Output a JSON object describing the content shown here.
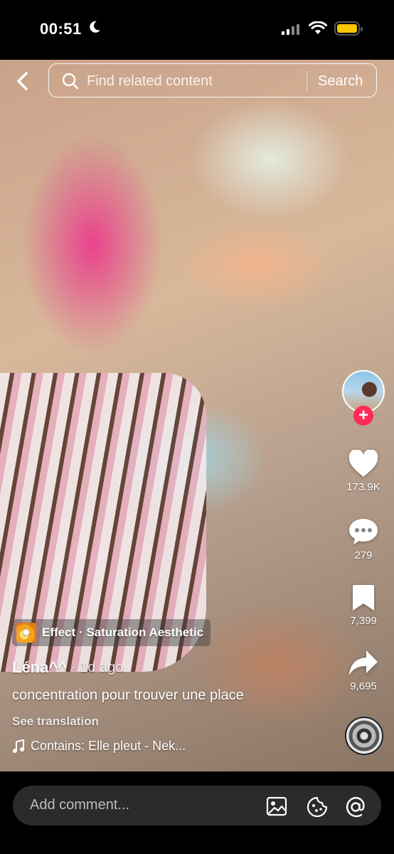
{
  "status": {
    "time": "00:51"
  },
  "nav": {
    "search_placeholder": "Find related content",
    "search_button": "Search"
  },
  "rail": {
    "likes": "173.9K",
    "comments": "279",
    "saves": "7,399",
    "shares": "9,695"
  },
  "caption": {
    "effect": "Effect · Saturation Aesthetic",
    "username": "Léna^^",
    "time": "· 1d ago",
    "description": "concentration pour trouver une place",
    "see_translation": "See translation",
    "music": "Contains: Elle pleut - Nek..."
  },
  "comment": {
    "placeholder": "Add comment..."
  },
  "colors": {
    "follow": "#fe2c55",
    "battery": "#f7c600",
    "comment_bg": "#2b2b2b"
  }
}
